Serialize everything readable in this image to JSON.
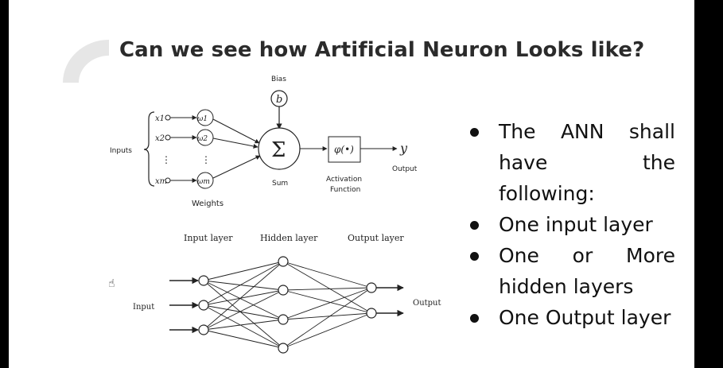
{
  "slide": {
    "title": "Can we see how Artificial Neuron Looks like?",
    "background": "#ffffff",
    "frame_color": "#000000",
    "accent_decoration_color": "#e6e6e6"
  },
  "neuron_diagram": {
    "bias_label": "Bias",
    "bias_symbol": "b",
    "inputs_label": "Inputs",
    "inputs": [
      "x1",
      "x2",
      "⋮",
      "xm"
    ],
    "weights": [
      "ω1",
      "ω2",
      "⋮",
      "ωm"
    ],
    "weights_label": "Weights",
    "sum_symbol": "Σ",
    "sum_label": "Sum",
    "activation_symbol": "φ(•)",
    "activation_label_line1": "Activation",
    "activation_label_line2": "Function",
    "output_symbol": "y",
    "output_label": "Output"
  },
  "network_diagram": {
    "input_layer_label": "Input layer",
    "hidden_layer_label": "Hidden layer",
    "output_layer_label": "Output layer",
    "input_label": "Input",
    "output_label": "Output",
    "input_nodes": 3,
    "hidden_nodes": 4,
    "output_nodes": 2
  },
  "bullets": {
    "item1_line1": "The ANN shall",
    "item1_line2": "have the",
    "item1_line3": "following:",
    "item2": "One input layer",
    "item3_line1": "One or More",
    "item3_line2": "hidden layers",
    "item4": "One Output layer"
  },
  "cursor_icon": "hand-cursor-icon"
}
